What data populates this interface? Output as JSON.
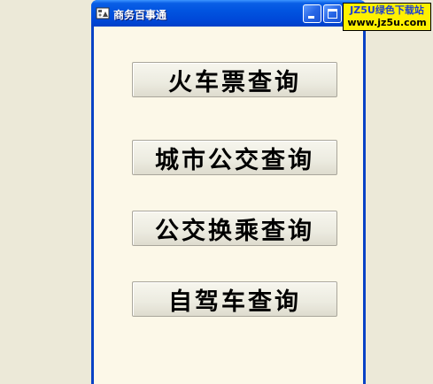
{
  "window": {
    "title": "商务百事通",
    "icon": "app-icon"
  },
  "buttons": [
    {
      "label": "火车票查询"
    },
    {
      "label": "城市公交查询"
    },
    {
      "label": "公交换乘查询"
    },
    {
      "label": "自驾车查询"
    }
  ],
  "watermark": {
    "line1": "JZ5U绿色下载站",
    "line2": "www.jz5u.com"
  },
  "colors": {
    "desktop": "#ece9d8",
    "titlebar": "#0054e3",
    "client": "#fcf8e8",
    "watermark_bg": "#fff000"
  }
}
